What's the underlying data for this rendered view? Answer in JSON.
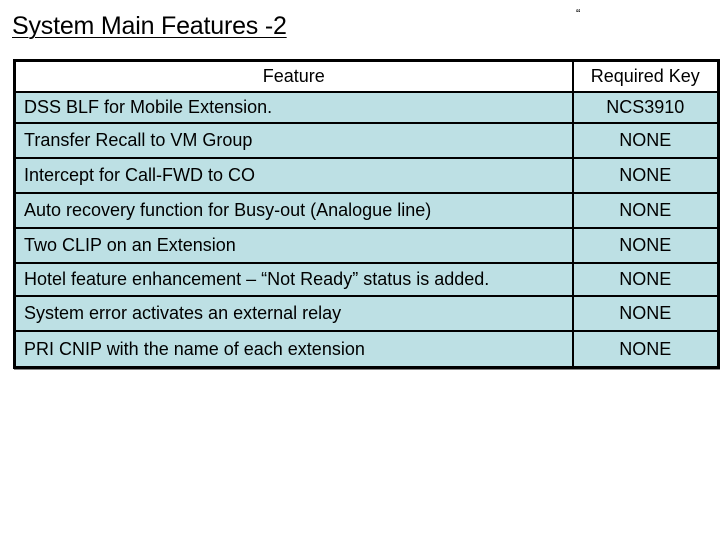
{
  "slide": {
    "title": "System Main Features -2",
    "stray_mark": "“"
  },
  "table": {
    "headers": {
      "feature": "Feature",
      "required_key": "Required Key"
    },
    "rows": [
      {
        "feature": "DSS BLF for Mobile Extension.",
        "required_key": "NCS3910"
      },
      {
        "feature": "Transfer Recall to VM Group",
        "required_key": "NONE"
      },
      {
        "feature": "Intercept for Call-FWD to CO",
        "required_key": "NONE"
      },
      {
        "feature": "Auto recovery function for Busy-out  (Analogue line)",
        "required_key": "NONE"
      },
      {
        "feature": "Two CLIP on an Extension",
        "required_key": "NONE"
      },
      {
        "feature": "Hotel feature enhancement – “Not Ready” status is added.",
        "required_key": "NONE"
      },
      {
        "feature": "System error activates an external relay",
        "required_key": "NONE"
      },
      {
        "feature": "PRI CNIP with the name of each extension",
        "required_key": "NONE"
      }
    ]
  },
  "colors": {
    "row_fill": "#bde0e4",
    "header_fill": "#ffffff",
    "border": "#000000"
  }
}
